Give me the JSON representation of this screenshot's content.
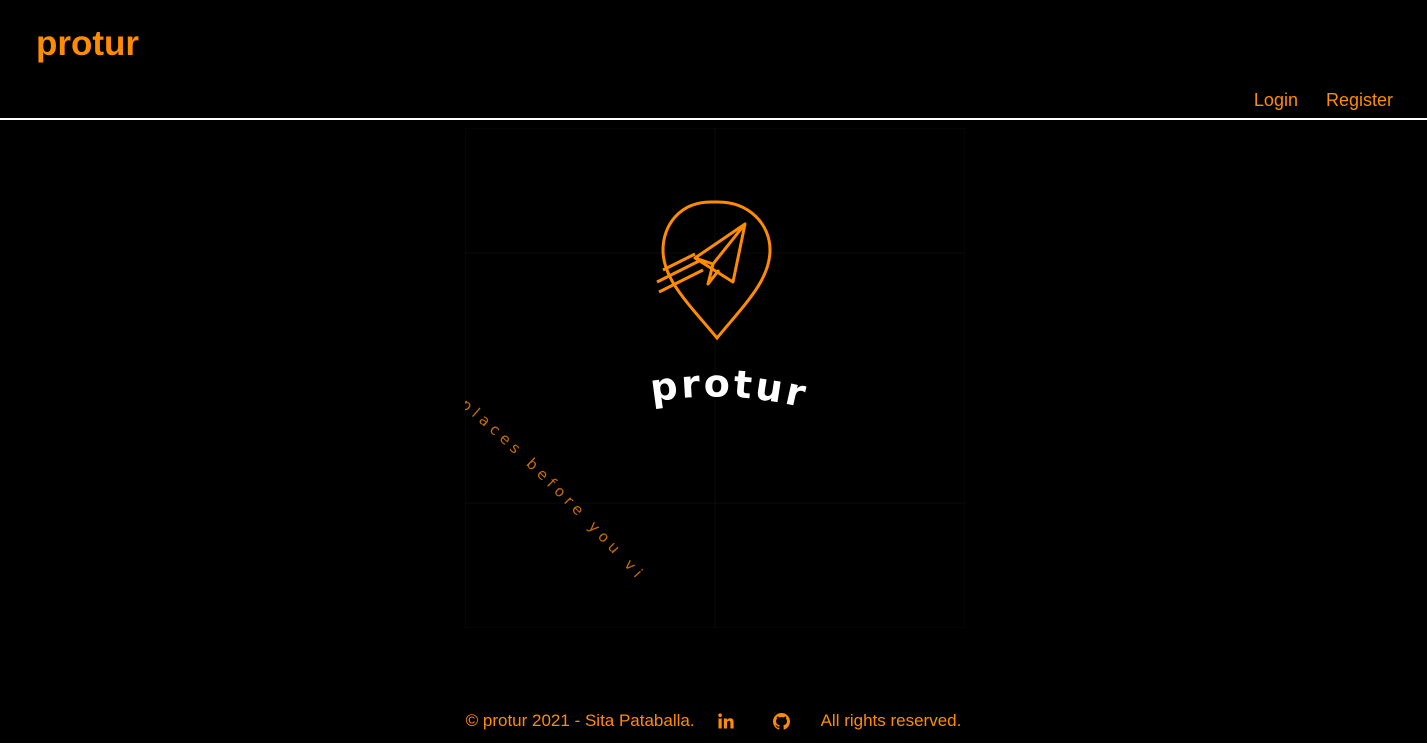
{
  "navbar": {
    "brand": "protur",
    "links": [
      {
        "label": "Login"
      },
      {
        "label": "Register"
      }
    ]
  },
  "hero": {
    "logo_text": "protur",
    "tagline_visible": "places before you visit",
    "logo_icon": "paper-plane-map-pin-icon"
  },
  "footer": {
    "copyright": "© protur 2021 - Sita Pataballa.",
    "linkedin_icon": "linkedin-icon",
    "github_icon": "github-icon",
    "rights": "All rights reserved."
  },
  "colors": {
    "accent": "#ff8c00",
    "background": "#000000",
    "logo_text": "#ffffff",
    "divider": "#ffffff"
  }
}
